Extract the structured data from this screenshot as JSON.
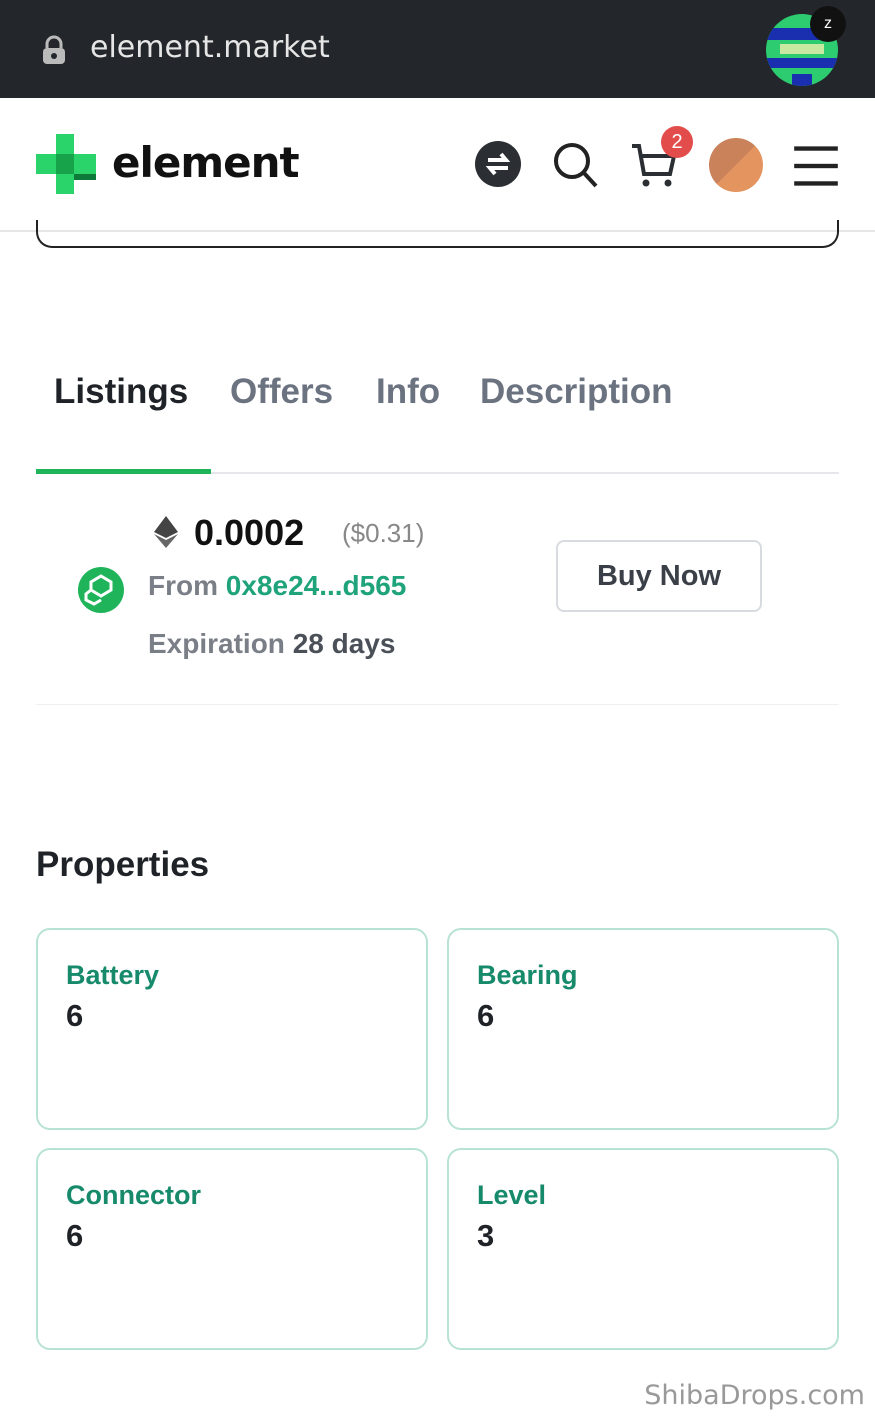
{
  "browser": {
    "url": "element.market",
    "tab_badge": "z"
  },
  "header": {
    "brand": "element",
    "cart_count": "2",
    "icons": [
      "swap-icon",
      "search-icon",
      "cart-icon",
      "avatar",
      "menu-icon"
    ]
  },
  "tabs": [
    {
      "label": "Listings",
      "active": true
    },
    {
      "label": "Offers"
    },
    {
      "label": "Info"
    },
    {
      "label": "Description"
    }
  ],
  "listing": {
    "price": "0.0002",
    "usd": "($0.31)",
    "from_label": "From",
    "from_address": "0x8e24...d565",
    "expiration_label": "Expiration",
    "expiration_value": "28 days",
    "buy_label": "Buy Now"
  },
  "properties": {
    "title": "Properties",
    "items": [
      {
        "key": "Battery",
        "value": "6"
      },
      {
        "key": "Bearing",
        "value": "6"
      },
      {
        "key": "Connector",
        "value": "6"
      },
      {
        "key": "Level",
        "value": "3"
      }
    ]
  },
  "watermark": "ShibaDrops.com",
  "colors": {
    "accent": "#1fb45a",
    "address": "#1fa37a",
    "property_key": "#168a6a",
    "badge": "#e24c4b"
  }
}
